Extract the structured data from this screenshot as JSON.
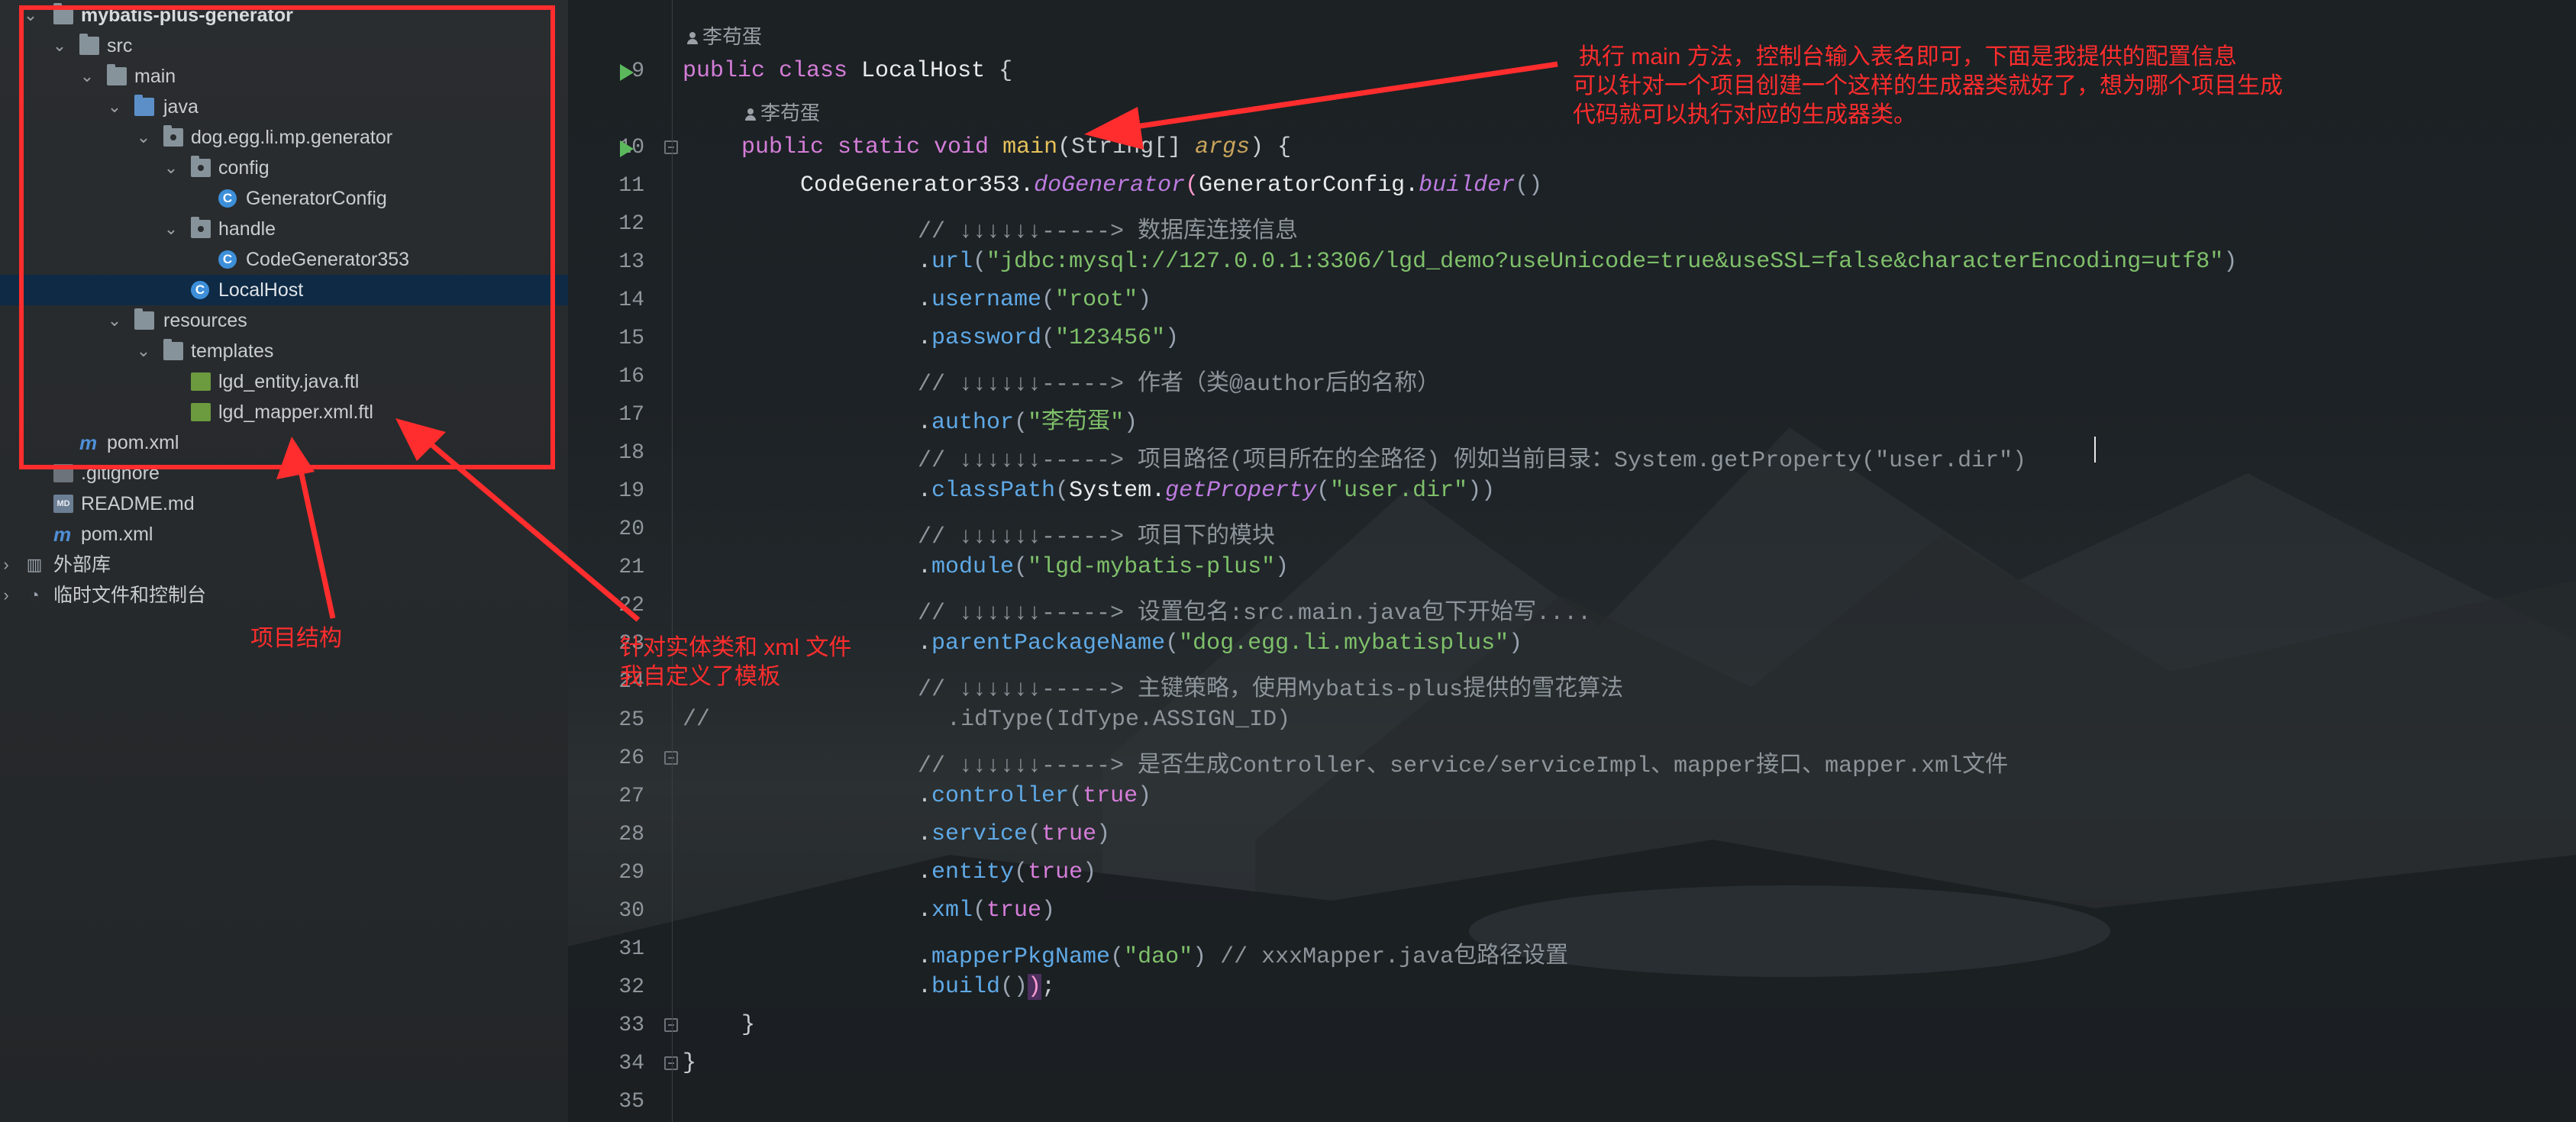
{
  "project_tree": {
    "items": [
      {
        "label": "mybatis-plus-generator",
        "icon": "folder-module-icon"
      },
      {
        "label": "src",
        "icon": "folder-icon"
      },
      {
        "label": "main",
        "icon": "folder-icon"
      },
      {
        "label": "java",
        "icon": "source-folder-icon"
      },
      {
        "label": "dog.egg.li.mp.generator",
        "icon": "package-icon"
      },
      {
        "label": "config",
        "icon": "package-icon"
      },
      {
        "label": "GeneratorConfig",
        "icon": "class-icon"
      },
      {
        "label": "handle",
        "icon": "package-icon"
      },
      {
        "label": "CodeGenerator353",
        "icon": "class-icon"
      },
      {
        "label": "LocalHost",
        "icon": "class-run-icon"
      },
      {
        "label": "resources",
        "icon": "resources-folder-icon"
      },
      {
        "label": "templates",
        "icon": "folder-icon"
      },
      {
        "label": "lgd_entity.java.ftl",
        "icon": "ftl-file-icon"
      },
      {
        "label": "lgd_mapper.xml.ftl",
        "icon": "ftl-file-icon"
      },
      {
        "label": "pom.xml",
        "icon": "maven-icon"
      },
      {
        "label": ".gitignore",
        "icon": "file-icon"
      },
      {
        "label": "README.md",
        "icon": "markdown-icon"
      },
      {
        "label": "pom.xml",
        "icon": "maven-icon"
      },
      {
        "label": "外部库",
        "icon": "library-icon"
      },
      {
        "label": "临时文件和控制台",
        "icon": "scratch-icon"
      }
    ]
  },
  "editor": {
    "author_hints": [
      "李苟蛋",
      "李苟蛋"
    ],
    "line_numbers": [
      "9",
      "10",
      "11",
      "12",
      "13",
      "14",
      "15",
      "16",
      "17",
      "18",
      "19",
      "20",
      "21",
      "22",
      "23",
      "24",
      "25",
      "26",
      "27",
      "28",
      "29",
      "30",
      "31",
      "32",
      "33",
      "34",
      "35"
    ],
    "lines": {
      "l9": {
        "kw": "public class ",
        "name": "LocalHost",
        "rest": " {"
      },
      "l10": {
        "kw": "public static void ",
        "fn": "main",
        "p1": "(String",
        "bracket": "[]",
        "p2": " ",
        "arg": "args",
        "p3": ") {"
      },
      "l11": {
        "cls": "CodeGenerator353.",
        "method": "doGenerator",
        "p1": "(",
        "cls2": "GeneratorConfig.",
        "method2": "builder",
        "p2": "()"
      },
      "l12": {
        "comment": "// ↓↓↓↓↓↓-----> 数据库连接信息"
      },
      "l13": {
        "dot": ".",
        "method": "url",
        "p1": "(",
        "str": "\"jdbc:mysql://127.0.0.1:3306/lgd_demo?useUnicode=true&useSSL=false&characterEncoding=utf8\"",
        "p2": ")"
      },
      "l14": {
        "dot": ".",
        "method": "username",
        "p1": "(",
        "str": "\"root\"",
        "p2": ")"
      },
      "l15": {
        "dot": ".",
        "method": "password",
        "p1": "(",
        "str": "\"123456\"",
        "p2": ")"
      },
      "l16": {
        "comment": "// ↓↓↓↓↓↓-----> 作者（类@author后的名称）"
      },
      "l17": {
        "dot": ".",
        "method": "author",
        "p1": "(",
        "str": "\"李苟蛋\"",
        "p2": ")"
      },
      "l18": {
        "comment": "// ↓↓↓↓↓↓-----> 项目路径(项目所在的全路径) 例如当前目录：System.getProperty(\"user.dir\")"
      },
      "l19": {
        "dot": ".",
        "method": "classPath",
        "p1": "(",
        "cls": "System.",
        "method2": "getProperty",
        "p2": "(",
        "str": "\"user.dir\"",
        "p3": "))"
      },
      "l20": {
        "comment": "// ↓↓↓↓↓↓-----> 项目下的模块"
      },
      "l21": {
        "dot": ".",
        "method": "module",
        "p1": "(",
        "str": "\"lgd-mybatis-plus\"",
        "p2": ")"
      },
      "l22": {
        "comment": "// ↓↓↓↓↓↓-----> 设置包名:src.main.java包下开始写...."
      },
      "l23": {
        "dot": ".",
        "method": "parentPackageName",
        "p1": "(",
        "str": "\"dog.egg.li.mybatisplus\"",
        "p2": ")"
      },
      "l24": {
        "comment": "// ↓↓↓↓↓↓-----> 主键策略，使用Mybatis-plus提供的雪花算法"
      },
      "l25": {
        "comment1": "//",
        "comment2": ".idType(IdType.ASSIGN_ID)"
      },
      "l26": {
        "comment": "// ↓↓↓↓↓↓-----> 是否生成Controller、service/serviceImpl、mapper接口、mapper.xml文件"
      },
      "l27": {
        "dot": ".",
        "method": "controller",
        "p1": "(",
        "val": "true",
        "p2": ")"
      },
      "l28": {
        "dot": ".",
        "method": "service",
        "p1": "(",
        "val": "true",
        "p2": ")"
      },
      "l29": {
        "dot": ".",
        "method": "entity",
        "p1": "(",
        "val": "true",
        "p2": ")"
      },
      "l30": {
        "dot": ".",
        "method": "xml",
        "p1": "(",
        "val": "true",
        "p2": ")"
      },
      "l31": {
        "dot": ".",
        "method": "mapperPkgName",
        "p1": "(",
        "str": "\"dao\"",
        "p2": ") ",
        "comment": "// xxxMapper.java包路径设置"
      },
      "l32": {
        "dot": ".",
        "method": "build",
        "p1": "()",
        "p2": ")",
        "p3": ";"
      },
      "l33": {
        "text": "}"
      },
      "l34": {
        "text": "}"
      }
    }
  },
  "annotations": {
    "top_right": [
      "执行 main 方法，控制台输入表名即可，下面是我提供的配置信息",
      "可以针对一个项目创建一个这样的生成器类就好了，想为哪个项目生成",
      "代码就可以执行对应的生成器类。"
    ],
    "project_structure": "项目结构",
    "templates_note": [
      "针对实体类和 xml 文件",
      "我自定义了模板"
    ]
  },
  "colors": {
    "annotation_red": "#ff2d2d",
    "selection": "#0e2a45",
    "keyword": "#d47dd8",
    "string": "#7fc06a",
    "method": "#5fa9e6"
  }
}
